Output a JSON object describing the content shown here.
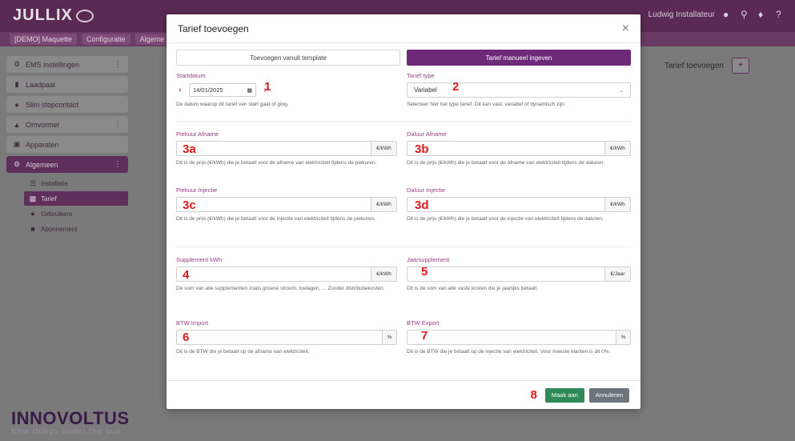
{
  "app": {
    "logo": "JULLIX",
    "user_name": "Ludwig Installateur",
    "breadcrumb": [
      "[DEMO] Maquette",
      "Configuratie",
      "Algeme"
    ]
  },
  "sidebar": {
    "items": [
      {
        "label": "EMS instellingen",
        "icon": "gear-icon",
        "has_menu": true
      },
      {
        "label": "Laadpaal",
        "icon": "charger-icon",
        "has_menu": false
      },
      {
        "label": "Slim stopcontact",
        "icon": "plug-icon",
        "has_menu": false
      },
      {
        "label": "Omvormer",
        "icon": "inverter-icon",
        "has_menu": true
      },
      {
        "label": "Apparaten",
        "icon": "devices-icon",
        "has_menu": false
      },
      {
        "label": "Algemeen",
        "icon": "cog-icon",
        "has_menu": true
      }
    ],
    "sub_items": [
      {
        "label": "Installatie",
        "icon": "installation-icon"
      },
      {
        "label": "Tarief",
        "icon": "chart-icon"
      },
      {
        "label": "Gebruikers",
        "icon": "users-icon"
      },
      {
        "label": "Abonnement",
        "icon": "subscription-icon"
      }
    ]
  },
  "background_action": {
    "label": "Tarief toevoegen",
    "button": "+"
  },
  "brand": {
    "name": "INNOVOLTUS",
    "tagline": "New things under the sun"
  },
  "modal": {
    "title": "Tarief toevoegen",
    "close": "×",
    "mode_template": "Toevoegen vanuit template",
    "mode_manual": "Tarief manueel ingeven",
    "startdatum": {
      "label": "Startdatum",
      "prev": "‹",
      "next": "›",
      "value": "14/01/2025",
      "help": "De datum waarop dit tarief van start gaat of ging."
    },
    "tarief_type": {
      "label": "Tarief type",
      "value": "Variabel",
      "help": "Selecteer hier het type tarief. Dit kan vast, variabel of dynamisch zijn."
    },
    "piekuur_afname": {
      "label": "Piekuur Afname",
      "unit": "€/kWh",
      "help": "Dit is de prijs (€/kWh) die je betaalt voor de afname van elektriciteit tijdens de piekuren."
    },
    "daluur_afname": {
      "label": "Daluur Afname",
      "unit": "€/kWh",
      "help": "Dit is de prijs (€/kWh) die je betaalt voor de afname van elektriciteit tijdens de daluren."
    },
    "piekuur_injectie": {
      "label": "Piekuur Injectie",
      "unit": "€/kWh",
      "help": "Dit is de prijs (€/kWh) die je betaalt voor de injectie van elektriciteit tijdens de piekuren."
    },
    "daluur_injectie": {
      "label": "Daluur Injectie",
      "unit": "€/kWh",
      "help": "Dit is de prijs (€/kWh) die je betaalt voor de injectie van elektriciteit tijdens de daluren."
    },
    "supplement_kwh": {
      "label": "Supplement kWh",
      "unit": "€/kWh",
      "help": "De som van alle supplementen zoals groene stroom, toelagen, ... Zonder distributiekosten."
    },
    "jaarsupplement": {
      "label": "Jaarsupplement",
      "unit": "€/Jaar",
      "help": "Dit is de som van alle vaste kosten die je jaarlijks betaalt."
    },
    "btw_import": {
      "label": "BTW Import",
      "unit": "%",
      "help": "Dit is de BTW die je betaalt op de afname van elektriciteit."
    },
    "btw_export": {
      "label": "BTW Export",
      "unit": "%",
      "help": "Dit is de BTW die je betaalt op de injectie van elektriciteit. Voor meeste klanten is dit 0%."
    },
    "save": "Maak aan",
    "cancel": "Annuleren"
  },
  "annotations": {
    "m1": "1",
    "m2": "2",
    "m3a": "3a",
    "m3b": "3b",
    "m3c": "3c",
    "m3d": "3d",
    "m4": "4",
    "m5": "5",
    "m6": "6",
    "m7": "7",
    "m8": "8",
    "color": "#e01818"
  }
}
